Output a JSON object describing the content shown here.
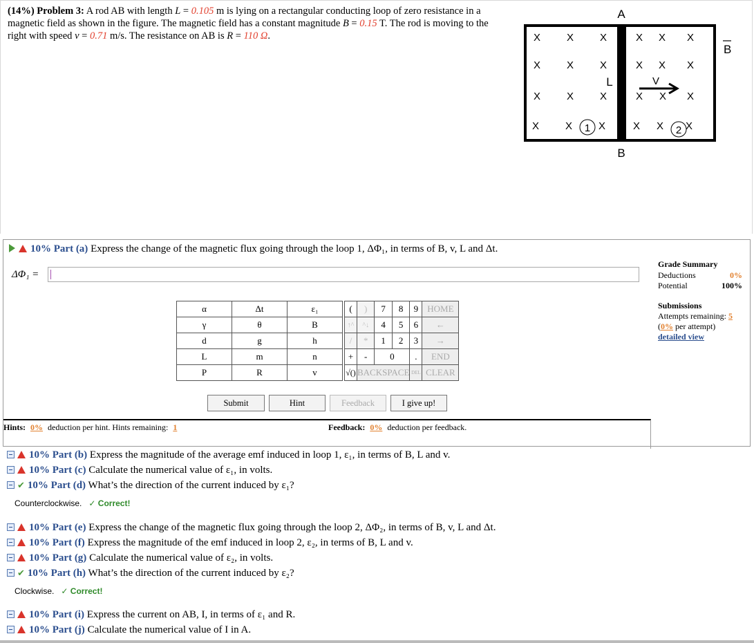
{
  "problem": {
    "weight": "(14%)",
    "title": "Problem 3:",
    "t1": "A rod AB with length ",
    "L_sym": "L",
    "eq": " = ",
    "L_val": "0.105",
    "t2": " m is lying on a rectangular conducting loop of zero resistance in a magnetic field as shown in the figure. The magnetic field has a constant magnitude ",
    "B_sym": "B",
    "B_val": "0.15",
    "t3": " T. The rod is moving to the right with speed ",
    "v_sym": "v",
    "v_val": "0.71",
    "t4": " m/s. The resistance on AB is ",
    "R_sym": "R",
    "R_val": "110 Ω",
    "t5": "."
  },
  "figure": {
    "label_A": "A",
    "label_B": "B",
    "label_L": "L",
    "label_v": "V",
    "label_Bvec": "B",
    "loop1": "1",
    "loop2": "2",
    "x_mark": "X"
  },
  "part_a": {
    "pct": "10% Part (a)",
    "text": " Express the change of the magnetic flux going through the loop 1, ΔΦ₁, in terms of B, v, L and Δt.",
    "answer_label": "ΔΦ₁ =",
    "answer_value": ""
  },
  "keypad": {
    "vars": [
      [
        "α",
        "Δt",
        "ε₁"
      ],
      [
        "γ",
        "θ",
        "B"
      ],
      [
        "d",
        "g",
        "h"
      ],
      [
        "L",
        "m",
        "n"
      ],
      [
        "P",
        "R",
        "v"
      ]
    ],
    "row1": [
      "(",
      ")",
      "7",
      "8",
      "9",
      "HOME"
    ],
    "row2": [
      "↑^",
      "^↓",
      "4",
      "5",
      "6",
      "←"
    ],
    "row3": [
      "/",
      "*",
      "1",
      "2",
      "3",
      "→"
    ],
    "row4": [
      "+",
      "-",
      "0",
      ".",
      "END"
    ],
    "row5": [
      "√()",
      "BACKSPACE",
      "DEL",
      "CLEAR"
    ]
  },
  "buttons": {
    "submit": "Submit",
    "hint": "Hint",
    "feedback": "Feedback",
    "give_up": "I give up!"
  },
  "hints": {
    "label": "Hints:",
    "pct": "0%",
    "text": " deduction per hint. Hints remaining: ",
    "remaining": "1"
  },
  "feedback_info": {
    "label": "Feedback:",
    "pct": "0%",
    "text": " deduction per feedback."
  },
  "grade": {
    "title": "Grade Summary",
    "deductions_label": "Deductions",
    "deductions": "0%",
    "potential_label": "Potential",
    "potential": "100%",
    "submissions_title": "Submissions",
    "attempts_label": "Attempts remaining: ",
    "attempts": "5",
    "per_attempt_pct": "0%",
    "per_attempt_text": " per attempt)",
    "open_paren": "(",
    "detailed": "detailed view"
  },
  "parts": [
    {
      "pct": "10% Part (b)",
      "text": " Express the magnitude of the average emf induced in loop 1, ε₁, in terms of B, L and v."
    },
    {
      "pct": "10% Part (c)",
      "text": " Calculate the numerical value of ε₁, in volts."
    },
    {
      "pct": "10% Part (d)",
      "text": " What’s the direction of the current induced by ε₁?"
    },
    {
      "pct": "10% Part (e)",
      "text": " Express the change of the magnetic flux going through the loop 2, ΔΦ₂, in terms of B, v, L and Δt."
    },
    {
      "pct": "10% Part (f)",
      "text": " Express the magnitude of the emf induced in loop 2, ε₂, in terms of B, L and v."
    },
    {
      "pct": "10% Part (g)",
      "text": " Calculate the numerical value of ε₂, in volts."
    },
    {
      "pct": "10% Part (h)",
      "text": " What’s the direction of the current induced by ε₂?"
    },
    {
      "pct": "10% Part (i)",
      "text": " Express the current on AB, I, in terms of ε₁ and R."
    },
    {
      "pct": "10% Part (j)",
      "text": " Calculate the numerical value of I in A."
    }
  ],
  "status_d": {
    "answer": "Counterclockwise.",
    "result": "Correct!"
  },
  "status_h": {
    "answer": "Clockwise.",
    "result": "Correct!"
  },
  "colors": {
    "accent": "#2b4e8e",
    "value": "#e2412f",
    "correct": "#4b9a3a",
    "warning": "#d9342b"
  }
}
